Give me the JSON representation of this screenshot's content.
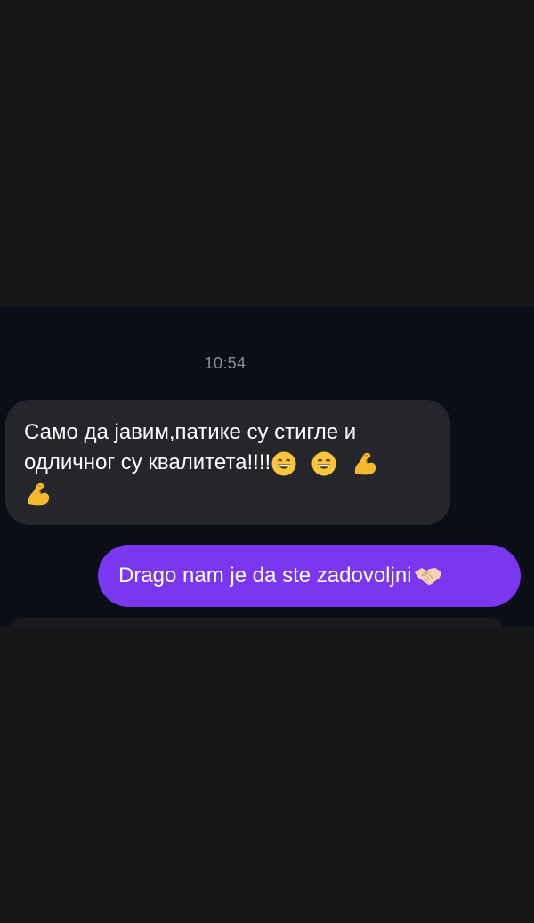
{
  "conversation": {
    "timestamp": "10:54",
    "incoming_message": {
      "text": "Само да јавим,патике су стигле и одличног су квалитета!!!!",
      "emojis": [
        "grinning-face-icon",
        "grinning-face-icon",
        "flexed-biceps-icon",
        "flexed-biceps-icon"
      ]
    },
    "outgoing_message": {
      "text": "Drago nam je da ste zadovoljni",
      "emojis": [
        "handshake-icon"
      ]
    }
  },
  "colors": {
    "background": "#0c0e17",
    "redaction": "#161719",
    "incoming_bubble": "#25262b",
    "outgoing_bubble": "#7a37ef",
    "timestamp_text": "#8e8f96"
  }
}
